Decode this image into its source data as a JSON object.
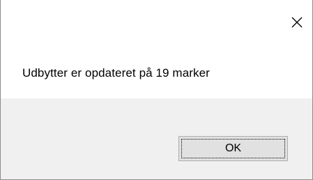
{
  "dialog": {
    "message": "Udbytter er opdateret på 19 marker",
    "ok_label": "OK",
    "close_icon": "close-icon"
  }
}
